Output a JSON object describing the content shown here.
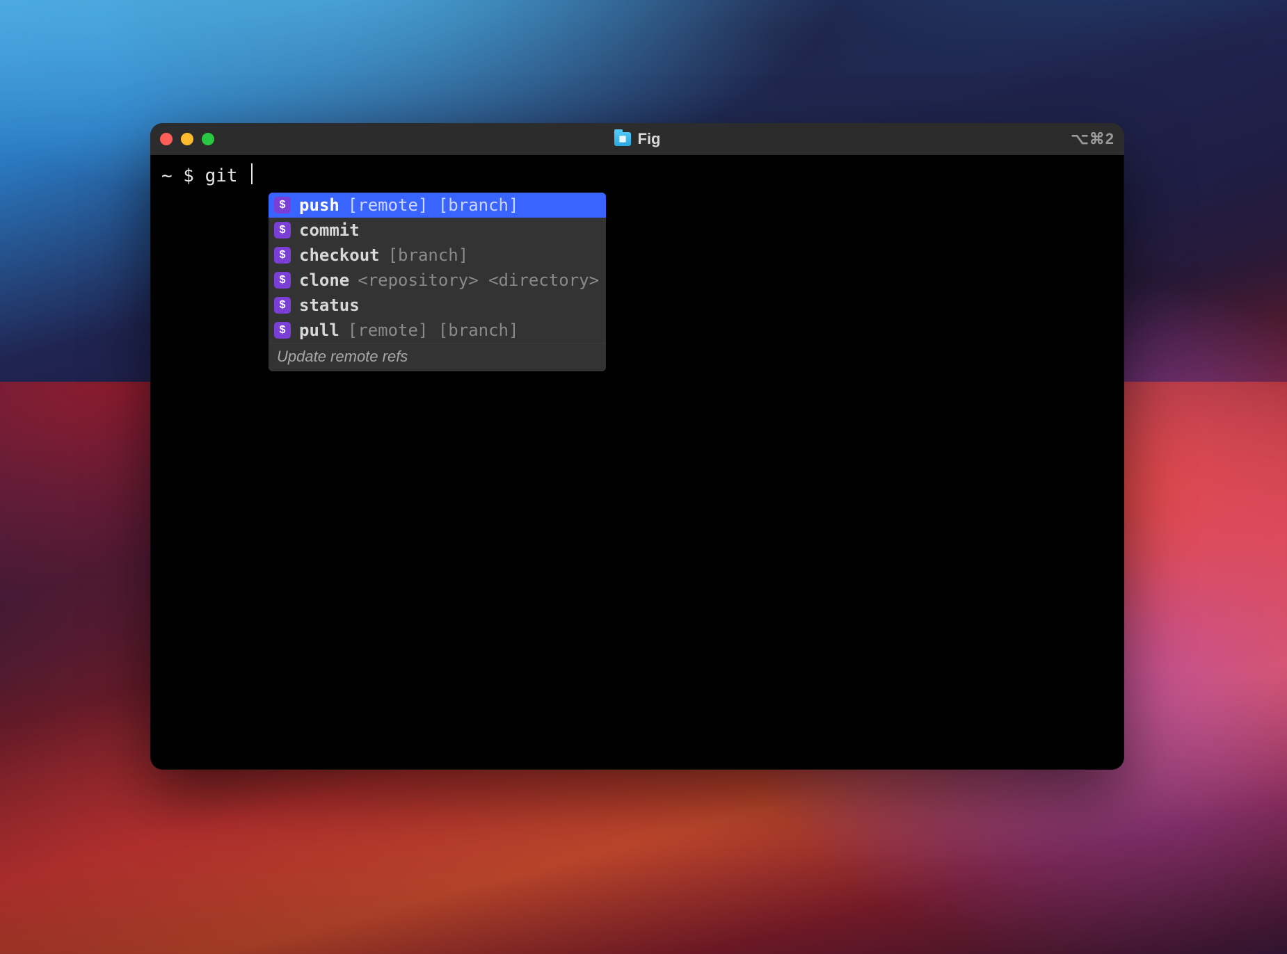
{
  "window": {
    "title": "Fig",
    "shortcut": "⌥⌘2"
  },
  "terminal": {
    "prompt": "~ $ ",
    "command": "git "
  },
  "autocomplete": {
    "selected_index": 0,
    "items": [
      {
        "icon": "$",
        "name": "push",
        "args": "[remote] [branch]"
      },
      {
        "icon": "$",
        "name": "commit",
        "args": ""
      },
      {
        "icon": "$",
        "name": "checkout",
        "args": "[branch]"
      },
      {
        "icon": "$",
        "name": "clone",
        "args": "<repository> <directory>"
      },
      {
        "icon": "$",
        "name": "status",
        "args": ""
      },
      {
        "icon": "$",
        "name": "pull",
        "args": "[remote] [branch]"
      }
    ],
    "description": "Update remote refs"
  }
}
